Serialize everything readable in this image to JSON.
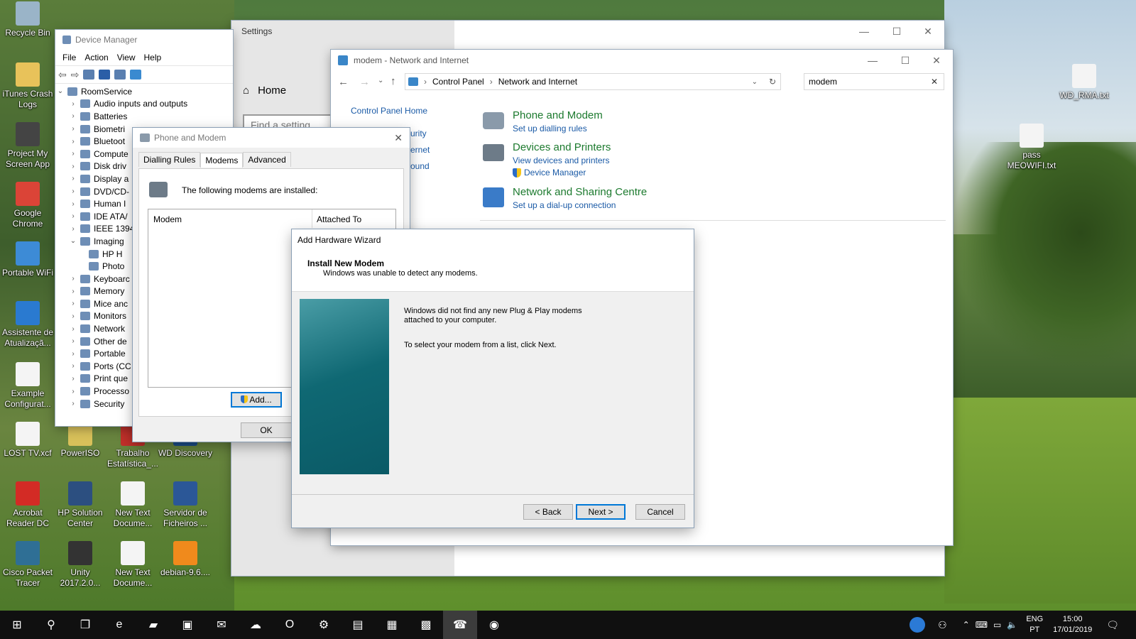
{
  "desktop": {
    "icons": [
      {
        "label": "Recycle Bin",
        "icon": "recycle-bin-icon",
        "color": "#9ab4c8"
      },
      {
        "label": "iTunes Crash Logs",
        "icon": "folder-icon",
        "color": "#e8c25a"
      },
      {
        "label": "Project My Screen App",
        "icon": "phone-icon",
        "color": "#444444"
      },
      {
        "label": "Google Chrome",
        "icon": "chrome-icon",
        "color": "#db4437"
      },
      {
        "label": "Portable WiFi",
        "icon": "wifi-icon",
        "color": "#3d8bd6"
      },
      {
        "label": "Assistente de Atualizaçã...",
        "icon": "update-icon",
        "color": "#2a7ad0"
      },
      {
        "label": "Example Configurat...",
        "icon": "document-icon",
        "color": "#f4f4f4"
      },
      {
        "label": "LOST TV.xcf",
        "icon": "document-icon",
        "color": "#f4f4f4"
      },
      {
        "label": "PowerISO",
        "icon": "disc-icon",
        "color": "#d8c05a"
      },
      {
        "label": "Trabalho Estatística_...",
        "icon": "pdf-icon",
        "color": "#c0302a"
      },
      {
        "label": "WD Discovery",
        "icon": "wd-icon",
        "color": "#1c4e8a"
      },
      {
        "label": "Acrobat Reader DC",
        "icon": "acrobat-icon",
        "color": "#d32b25"
      },
      {
        "label": "HP Solution Center",
        "icon": "hp-icon",
        "color": "#2c4f80"
      },
      {
        "label": "New Text Docume...",
        "icon": "text-file-icon",
        "color": "#f4f4f4"
      },
      {
        "label": "Servidor de Ficheiros ...",
        "icon": "word-icon",
        "color": "#2b5797"
      },
      {
        "label": "Cisco Packet Tracer",
        "icon": "cisco-icon",
        "color": "#2f6f95"
      },
      {
        "label": "Unity 2017.2.0...",
        "icon": "unity-icon",
        "color": "#333333"
      },
      {
        "label": "New Text Docume...",
        "icon": "text-file-icon",
        "color": "#f4f4f4"
      },
      {
        "label": "debian-9.6....",
        "icon": "vlc-icon",
        "color": "#f08a1c"
      },
      {
        "label": "WD_RMA.txt",
        "icon": "text-file-icon",
        "color": "#f4f4f4"
      },
      {
        "label": "pass MEOWIFI.txt",
        "icon": "text-file-icon",
        "color": "#f4f4f4"
      }
    ]
  },
  "device_manager": {
    "title": "Device Manager",
    "menu": [
      "File",
      "Action",
      "View",
      "Help"
    ],
    "root": "RoomService",
    "items": [
      {
        "label": "Audio inputs and outputs",
        "expanded": false
      },
      {
        "label": "Batteries",
        "expanded": false
      },
      {
        "label": "Biometri",
        "expanded": false
      },
      {
        "label": "Bluetoot",
        "expanded": false
      },
      {
        "label": "Compute",
        "expanded": false
      },
      {
        "label": "Disk driv",
        "expanded": false
      },
      {
        "label": "Display a",
        "expanded": false
      },
      {
        "label": "DVD/CD-",
        "expanded": false
      },
      {
        "label": "Human I",
        "expanded": false
      },
      {
        "label": "IDE ATA/",
        "expanded": false
      },
      {
        "label": "IEEE 1394",
        "expanded": false
      },
      {
        "label": "Imaging",
        "expanded": true
      },
      {
        "label": "HP H",
        "child": true
      },
      {
        "label": "Photo",
        "child": true
      },
      {
        "label": "Keyboarc",
        "expanded": false
      },
      {
        "label": "Memory",
        "expanded": false
      },
      {
        "label": "Mice anc",
        "expanded": false
      },
      {
        "label": "Monitors",
        "expanded": false
      },
      {
        "label": "Network",
        "expanded": false
      },
      {
        "label": "Other de",
        "expanded": false
      },
      {
        "label": "Portable",
        "expanded": false
      },
      {
        "label": "Ports (CC",
        "expanded": false
      },
      {
        "label": "Print que",
        "expanded": false
      },
      {
        "label": "Processo",
        "expanded": false
      },
      {
        "label": "Security",
        "expanded": false
      }
    ]
  },
  "settings": {
    "title": "Settings",
    "home": "Home",
    "search_placeholder": "Find a setting"
  },
  "explorer": {
    "title": "modem - Network and Internet",
    "breadcrumb": [
      "Control Panel",
      "Network and Internet"
    ],
    "search_value": "modem",
    "sidebar": {
      "home_link": "Control Panel Home",
      "partial_links": [
        "urity",
        "ernet",
        "ound"
      ]
    },
    "results": [
      {
        "heading": "Phone and Modem",
        "links": [
          "Set up dialling rules"
        ]
      },
      {
        "heading": "Devices and Printers",
        "links": [
          "View devices and printers",
          "Device Manager"
        ]
      },
      {
        "heading": "Network and Sharing Centre",
        "links": [
          "Set up a dial-up connection"
        ]
      }
    ]
  },
  "phone_modem": {
    "title": "Phone and Modem",
    "tabs": [
      "Dialling Rules",
      "Modems",
      "Advanced"
    ],
    "active_tab": "Modems",
    "message": "The following modems are installed:",
    "columns": [
      "Modem",
      "Attached To"
    ],
    "add_button": "Add...",
    "ok_button": "OK"
  },
  "wizard": {
    "title": "Add Hardware Wizard",
    "heading": "Install New Modem",
    "subheading": "Windows was unable to detect any modems.",
    "body_line1": "Windows did not find any new Plug & Play modems",
    "body_line2": "attached to your computer.",
    "body_line3": "To select your modem from a list, click Next.",
    "back_button": "< Back",
    "next_button": "Next >",
    "cancel_button": "Cancel"
  },
  "taskbar": {
    "items": [
      "start-icon",
      "search-icon",
      "task-view-icon",
      "edge-icon",
      "file-explorer-icon",
      "store-icon",
      "mail-icon",
      "cloud-icon",
      "outlook-icon",
      "settings-icon",
      "device-manager-icon",
      "network-icon",
      "control-panel-icon",
      "phone-modem-icon",
      "chrome-icon"
    ],
    "lang": "ENG",
    "region": "PT",
    "time": "15:00",
    "date": "17/01/2019"
  }
}
